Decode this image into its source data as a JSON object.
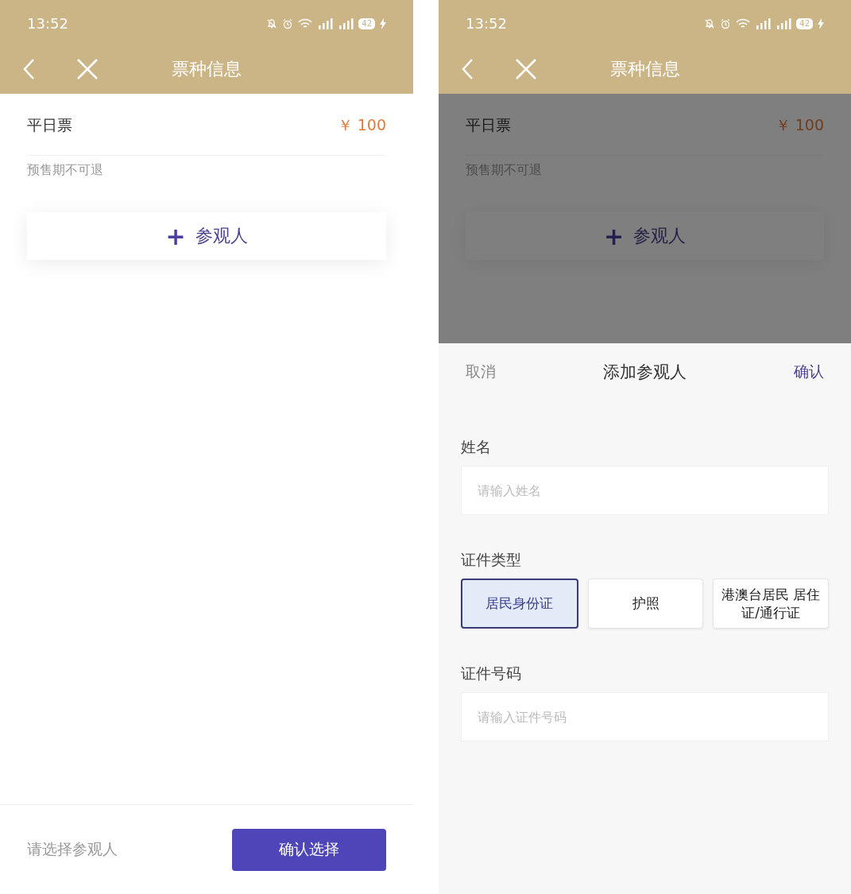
{
  "left_screen": {
    "status_bar": {
      "time": "13:52",
      "battery": "42"
    },
    "header": {
      "title": "票种信息"
    },
    "ticket": {
      "name": "平日票",
      "price": "￥ 100",
      "note": "预售期不可退"
    },
    "add_visitor": {
      "icon": "+",
      "label": "参观人"
    },
    "footer": {
      "hint": "请选择参观人",
      "button": "确认选择"
    }
  },
  "right_screen": {
    "status_bar": {
      "time": "13:52",
      "battery": "42"
    },
    "header": {
      "title": "票种信息"
    },
    "ticket": {
      "name": "平日票",
      "price": "￥ 100",
      "note": "预售期不可退"
    },
    "add_visitor": {
      "icon": "+",
      "label": "参观人"
    },
    "sheet": {
      "cancel": "取消",
      "title": "添加参观人",
      "confirm": "确认",
      "name_field": {
        "label": "姓名",
        "placeholder": "请输入姓名"
      },
      "id_type": {
        "label": "证件类型",
        "options": [
          {
            "label": "居民身份证",
            "selected": true
          },
          {
            "label": "护照",
            "selected": false
          },
          {
            "label": "港澳台居民 居住证/通行证",
            "selected": false
          }
        ]
      },
      "id_number_field": {
        "label": "证件号码",
        "placeholder": "请输入证件号码"
      }
    }
  }
}
